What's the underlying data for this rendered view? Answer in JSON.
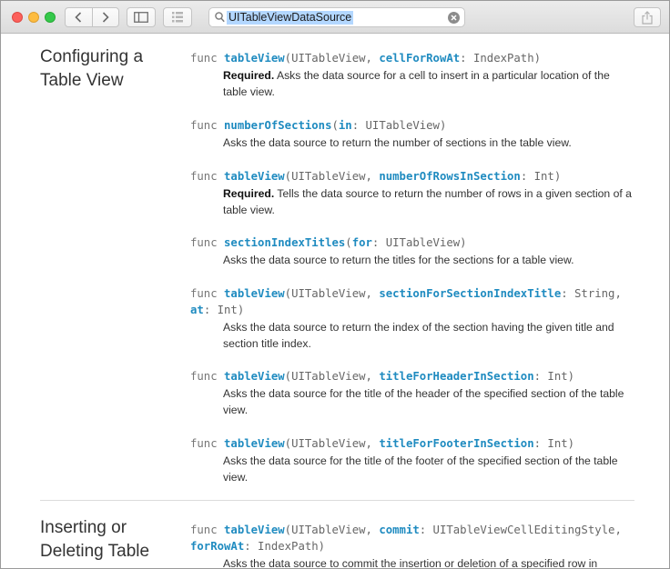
{
  "toolbar": {
    "search_query": "UITableViewDataSource"
  },
  "sections": [
    {
      "title": "Configuring a Table View",
      "methods": [
        {
          "sig_tokens": [
            "func ",
            "tableView",
            "(UITableView, ",
            "cellForRowAt",
            ": IndexPath)"
          ],
          "required": "Required.",
          "desc": "Asks the data source for a cell to insert in a particular location of the table view."
        },
        {
          "sig_tokens": [
            "func ",
            "numberOfSections",
            "(",
            "in",
            ": UITableView)"
          ],
          "required": "",
          "desc": "Asks the data source to return the number of sections in the table view."
        },
        {
          "sig_tokens": [
            "func ",
            "tableView",
            "(UITableView, ",
            "numberOfRowsInSection",
            ": Int)"
          ],
          "required": "Required.",
          "desc": "Tells the data source to return the number of rows in a given section of a table view."
        },
        {
          "sig_tokens": [
            "func ",
            "sectionIndexTitles",
            "(",
            "for",
            ": UITableView)"
          ],
          "required": "",
          "desc": "Asks the data source to return the titles for the sections for a table view."
        },
        {
          "sig_tokens": [
            "func ",
            "tableView",
            "(UITableView, ",
            "sectionForSectionIndexTitle",
            ": String,"
          ],
          "sig_line2": [
            "at",
            ": Int)"
          ],
          "required": "",
          "desc": "Asks the data source to return the index of the section having the given title and section title index."
        },
        {
          "sig_tokens": [
            "func ",
            "tableView",
            "(UITableView, ",
            "titleForHeaderInSection",
            ": Int)"
          ],
          "required": "",
          "desc": "Asks the data source for the title of the header of the specified section of the table view."
        },
        {
          "sig_tokens": [
            "func ",
            "tableView",
            "(UITableView, ",
            "titleForFooterInSection",
            ": Int)"
          ],
          "required": "",
          "desc": "Asks the data source for the title of the footer of the specified section of the table view."
        }
      ]
    },
    {
      "title": "Inserting or Deleting Table",
      "methods": [
        {
          "sig_tokens": [
            "func ",
            "tableView",
            "(UITableView, ",
            "commit",
            ": UITableViewCellEditingStyle,"
          ],
          "sig_line2": [
            "forRowAt",
            ": IndexPath)"
          ],
          "required": "",
          "desc": "Asks the data source to commit the insertion or deletion of a specified row in"
        }
      ]
    }
  ]
}
